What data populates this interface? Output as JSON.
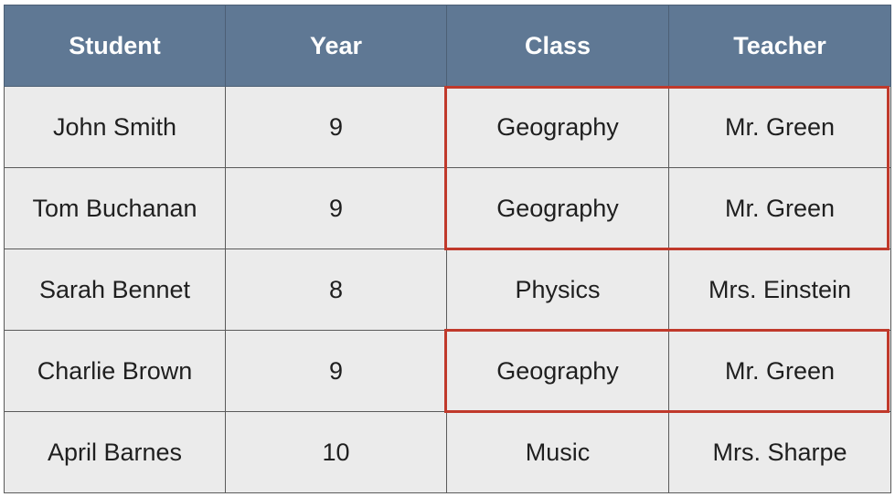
{
  "table": {
    "headers": [
      "Student",
      "Year",
      "Class",
      "Teacher"
    ],
    "rows": [
      [
        "John Smith",
        "9",
        "Geography",
        "Mr. Green"
      ],
      [
        "Tom Buchanan",
        "9",
        "Geography",
        "Mr. Green"
      ],
      [
        "Sarah Bennet",
        "8",
        "Physics",
        "Mrs. Einstein"
      ],
      [
        "Charlie Brown",
        "9",
        "Geography",
        "Mr. Green"
      ],
      [
        "April Barnes",
        "10",
        "Music",
        "Mrs. Sharpe"
      ]
    ]
  },
  "highlight": {
    "color": "#c0392b",
    "highlighted_rows": [
      [
        0,
        1
      ],
      [
        3
      ]
    ],
    "highlighted_columns": [
      "Class",
      "Teacher"
    ]
  },
  "colors": {
    "header_bg": "#5f7894",
    "header_text": "#ffffff",
    "cell_bg": "#ebebeb",
    "cell_text": "#1f1f1f"
  }
}
